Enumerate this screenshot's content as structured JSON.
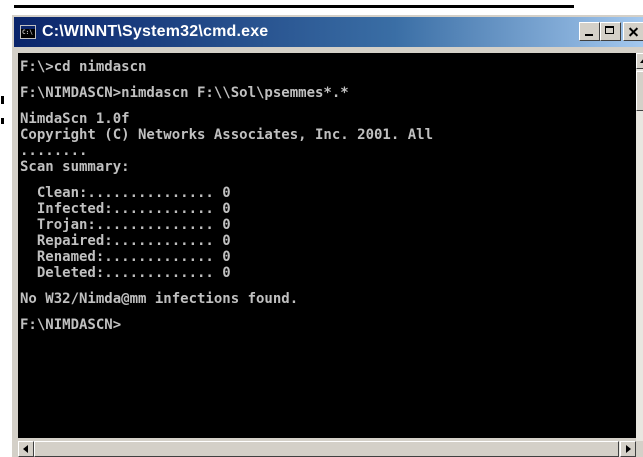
{
  "window": {
    "title": "C:\\WINNT\\System32\\cmd.exe",
    "icon": "cmd-icon"
  },
  "console": {
    "lines": [
      "F:\\>cd nimdascn",
      "",
      "F:\\NIMDASCN>nimdascn F:\\\\Sol\\psemmes*.*",
      "",
      "NimdaScn 1.0f",
      "Copyright (C) Networks Associates, Inc. 2001. All",
      "........",
      "Scan summary:",
      "",
      "  Clean:............... 0",
      "  Infected:............ 0",
      "  Trojan:.............. 0",
      "  Repaired:............ 0",
      "  Renamed:............. 0",
      "  Deleted:............. 0",
      "",
      "No W32/Nimda@mm infections found.",
      "",
      "F:\\NIMDASCN>"
    ]
  },
  "colors": {
    "console_bg": "#000000",
    "console_fg": "#c0c0c0",
    "titlebar_start": "#0a246a",
    "titlebar_end": "#a6caf0"
  }
}
